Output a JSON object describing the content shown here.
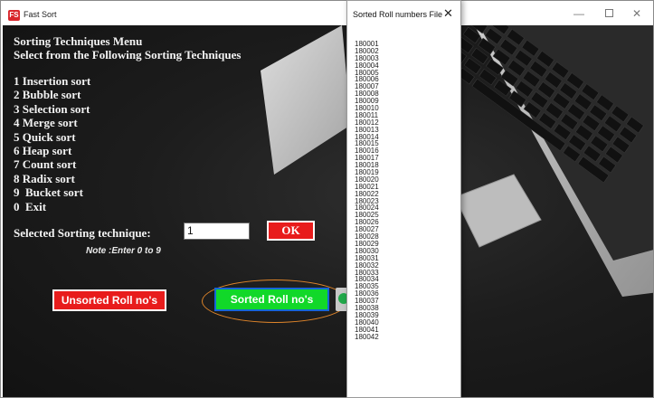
{
  "window": {
    "title": "Fast Sort",
    "app_icon": "FS",
    "controls": {
      "minimize": "—",
      "maximize": "",
      "close": "✕"
    }
  },
  "menu": {
    "title": "Sorting Techniques Menu",
    "subtitle": "Select from the Following Sorting Techniques",
    "items": [
      "1 Insertion sort",
      "2 Bubble sort",
      "3 Selection sort",
      "4 Merge sort",
      "5 Quick sort",
      "6 Heap sort",
      "7 Count sort",
      "8 Radix sort",
      "9  Bucket sort",
      "0  Exit"
    ]
  },
  "selection": {
    "label": "Selected Sorting technique:",
    "value": "1",
    "ok_label": "OK",
    "note": "Note :Enter 0 to 9"
  },
  "buttons": {
    "unsorted_label": "Unsorted Roll no's",
    "sorted_label": "Sorted Roll no's"
  },
  "popup": {
    "title": "Sorted Roll numbers File",
    "close": "✕",
    "rolls": [
      "180001",
      "180002",
      "180003",
      "180004",
      "180005",
      "180006",
      "180007",
      "180008",
      "180009",
      "180010",
      "180011",
      "180012",
      "180013",
      "180014",
      "180015",
      "180016",
      "180017",
      "180018",
      "180019",
      "180020",
      "180021",
      "180022",
      "180023",
      "180024",
      "180025",
      "180026",
      "180027",
      "180028",
      "180029",
      "180030",
      "180031",
      "180032",
      "180033",
      "180034",
      "180035",
      "180036",
      "180037",
      "180038",
      "180039",
      "180040",
      "180041",
      "180042"
    ]
  },
  "colors": {
    "ok_button": "#e81c1c",
    "unsorted_button": "#e81c1c",
    "sorted_button": "#11d829",
    "highlight_oval": "#e0852a",
    "canvas": "#1d1d1d"
  },
  "icons": {
    "app": "app-logo-icon",
    "side": "circle-icon"
  }
}
